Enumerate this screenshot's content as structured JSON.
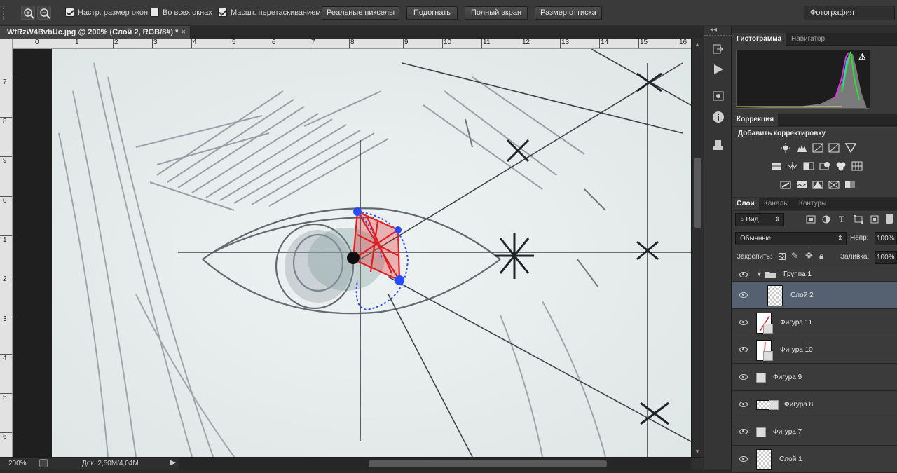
{
  "options_bar": {
    "resize_windows_label": "Настр. размер окон",
    "resize_windows_checked": true,
    "all_windows_label": "Во всех окнах",
    "all_windows_checked": false,
    "scrubby_zoom_label": "Масшт. перетаскиванием",
    "scrubby_zoom_checked": true,
    "actual_pixels_label": "Реальные пикселы",
    "fit_screen_label": "Подогнать",
    "fill_screen_label": "Полный экран",
    "print_size_label": "Размер оттиска",
    "workspace_label": "Фотография"
  },
  "document": {
    "tab_title": "WtRzW4BvbUc.jpg @ 200% (Слой 2, RGB/8#) *",
    "close_glyph": "×"
  },
  "rulers": {
    "horizontal": [
      "1",
      "2",
      "3",
      "4",
      "5",
      "6",
      "7",
      "8",
      "9",
      "10",
      "11",
      "12",
      "13",
      "14",
      "15",
      "16"
    ],
    "horizontal_leading": "0",
    "vertical": [
      "7",
      "8",
      "9",
      "0",
      "1",
      "2",
      "3",
      "4",
      "5",
      "6"
    ]
  },
  "status": {
    "zoom": "200%",
    "doc_info": "Док: 2,50M/4,04M"
  },
  "panels": {
    "histogram_tab": "Гистограмма",
    "navigator_tab": "Навигатор",
    "histogram_warning": "⚠",
    "correction_tab": "Коррекция",
    "add_adjustment_label": "Добавить корректировку",
    "layers_tab": "Слои",
    "channels_tab": "Каналы",
    "paths_tab": "Контуры",
    "filter_kind": "Вид",
    "blend_mode": "Обычные",
    "opacity_label": "Непр:",
    "opacity_value": "100%",
    "lock_label": "Закрепить:",
    "fill_label": "Заливка:",
    "fill_value": "100%"
  },
  "layers": [
    {
      "name": "Группа 1",
      "type": "group",
      "selected": false
    },
    {
      "name": "Слой 2",
      "type": "pixel",
      "selected": true
    },
    {
      "name": "Фигура 11",
      "type": "shape",
      "selected": false
    },
    {
      "name": "Фигура 10",
      "type": "shape",
      "selected": false
    },
    {
      "name": "Фигура 9",
      "type": "shape",
      "selected": false
    },
    {
      "name": "Фигура 8",
      "type": "shape",
      "selected": false
    },
    {
      "name": "Фигура 7",
      "type": "shape",
      "selected": false
    },
    {
      "name": "Слой 1",
      "type": "pixel",
      "selected": false
    }
  ],
  "colors": {
    "selection_red": "#e02020",
    "anchor_blue": "#2a4cff",
    "selected_layer": "#556070"
  }
}
